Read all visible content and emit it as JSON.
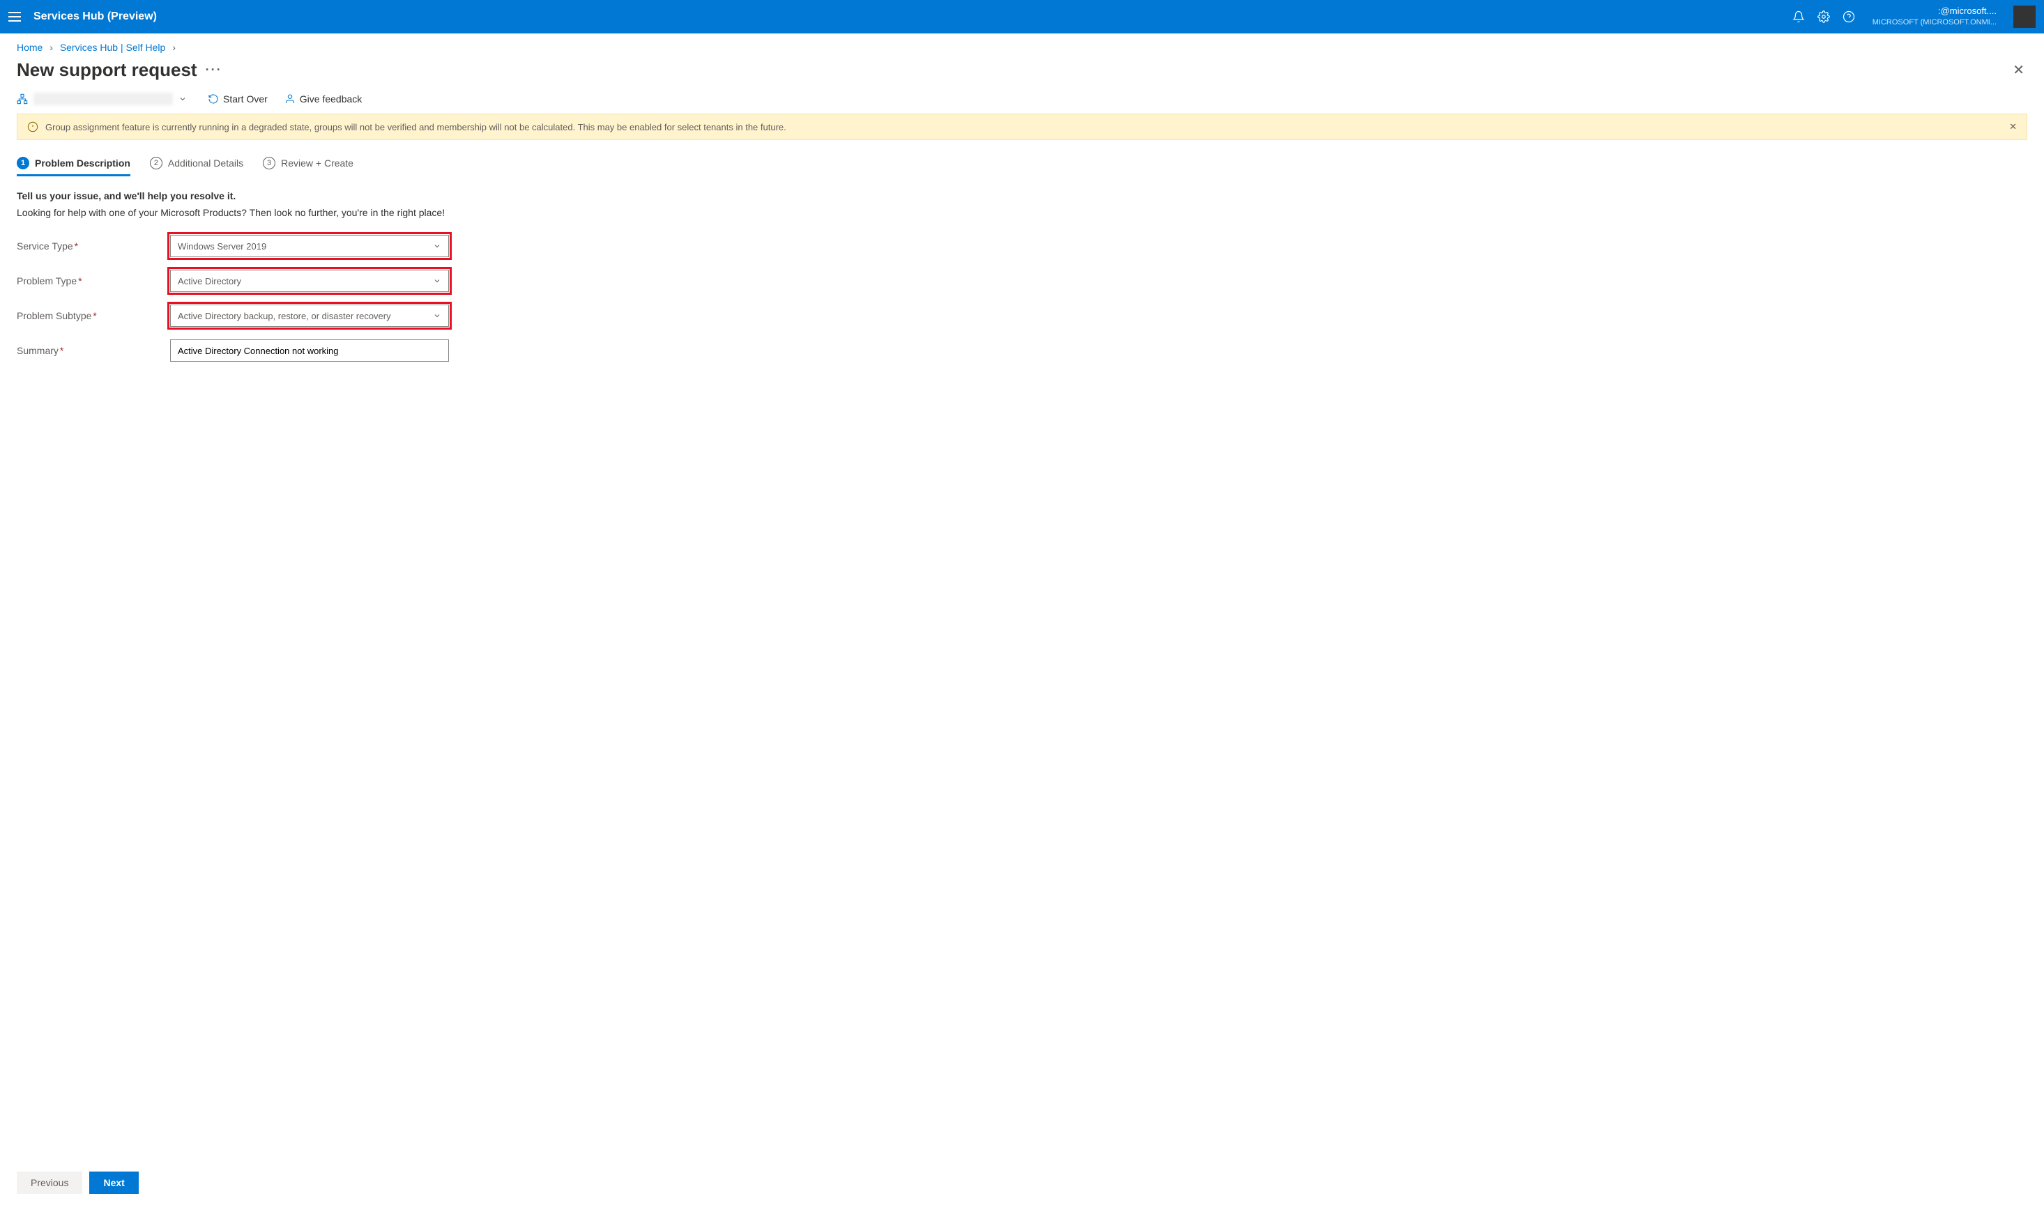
{
  "header": {
    "app_title": "Services Hub (Preview)",
    "user_email": ":@microsoft....",
    "user_tenant": "MICROSOFT (MICROSOFT.ONMI..."
  },
  "breadcrumb": {
    "home": "Home",
    "second": "Services Hub | Self Help"
  },
  "page": {
    "title": "New support request"
  },
  "toolbar": {
    "start_over": "Start Over",
    "give_feedback": "Give feedback"
  },
  "warning": {
    "text": "Group assignment feature is currently running in a degraded state, groups will not be verified and membership will not be calculated. This may be enabled for select tenants in the future."
  },
  "tabs": [
    {
      "num": "1",
      "label": "Problem Description",
      "active": true
    },
    {
      "num": "2",
      "label": "Additional Details",
      "active": false
    },
    {
      "num": "3",
      "label": "Review + Create",
      "active": false
    }
  ],
  "form": {
    "lead": "Tell us your issue, and we'll help you resolve it.",
    "sub": "Looking for help with one of your Microsoft Products? Then look no further, you're in the right place!",
    "fields": {
      "service_type": {
        "label": "Service Type",
        "value": "Windows Server 2019",
        "required": true,
        "highlight": true
      },
      "problem_type": {
        "label": "Problem Type",
        "value": "Active Directory",
        "required": true,
        "highlight": true
      },
      "problem_subtype": {
        "label": "Problem Subtype",
        "value": "Active Directory backup, restore, or disaster recovery",
        "required": true,
        "highlight": true
      },
      "summary": {
        "label": "Summary",
        "value": "Active Directory Connection not working",
        "required": true,
        "highlight": false
      }
    }
  },
  "footer": {
    "previous": "Previous",
    "next": "Next"
  }
}
